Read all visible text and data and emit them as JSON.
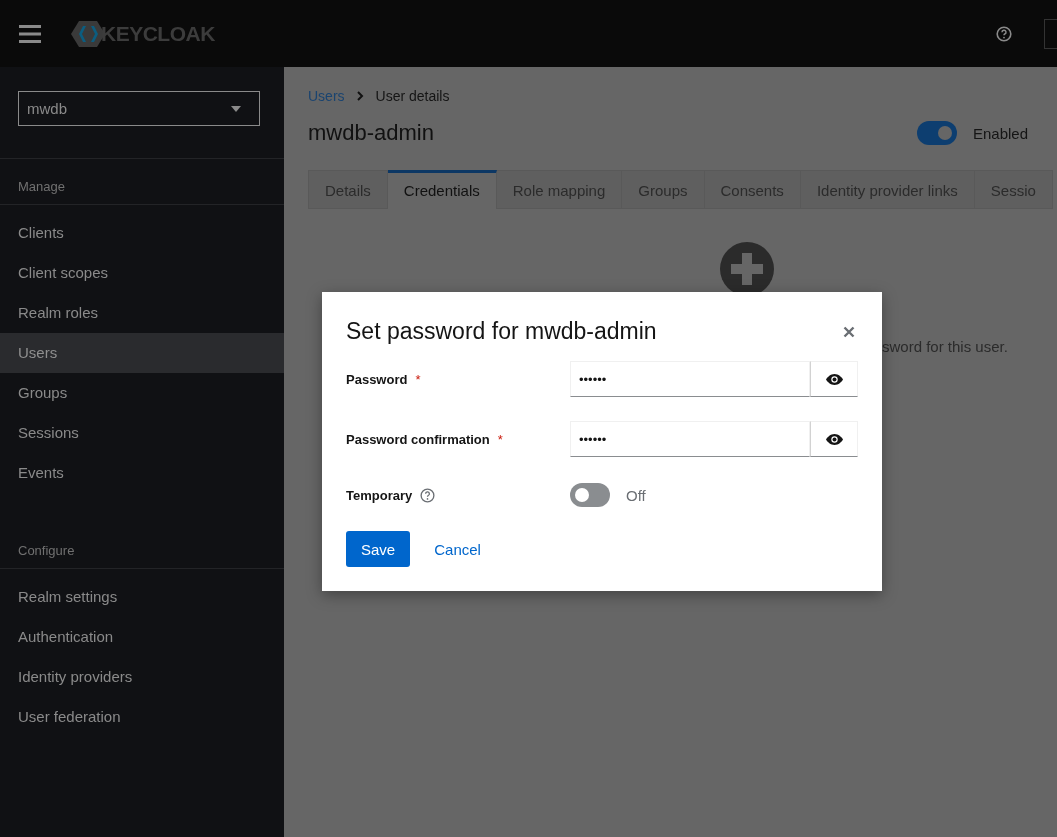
{
  "header": {
    "logo_text": "KEYCLOAK"
  },
  "sidebar": {
    "realm_select": "mwdb",
    "sections": [
      {
        "title": "Manage",
        "items": [
          {
            "label": "Clients",
            "selected": false
          },
          {
            "label": "Client scopes",
            "selected": false
          },
          {
            "label": "Realm roles",
            "selected": false
          },
          {
            "label": "Users",
            "selected": true
          },
          {
            "label": "Groups",
            "selected": false
          },
          {
            "label": "Sessions",
            "selected": false
          },
          {
            "label": "Events",
            "selected": false
          }
        ]
      },
      {
        "title": "Configure",
        "items": [
          {
            "label": "Realm settings",
            "selected": false
          },
          {
            "label": "Authentication",
            "selected": false
          },
          {
            "label": "Identity providers",
            "selected": false
          },
          {
            "label": "User federation",
            "selected": false
          }
        ]
      }
    ]
  },
  "breadcrumb": [
    {
      "label": "Users",
      "kind": "link"
    },
    {
      "label": "User details",
      "kind": "current"
    }
  ],
  "page_title": "mwdb-admin",
  "enabled_toggle": {
    "on": true,
    "label": "Enabled"
  },
  "tabs": [
    {
      "label": "Details",
      "selected": false
    },
    {
      "label": "Credentials",
      "selected": true
    },
    {
      "label": "Role mapping",
      "selected": false
    },
    {
      "label": "Groups",
      "selected": false
    },
    {
      "label": "Consents",
      "selected": false
    },
    {
      "label": "Identity provider links",
      "selected": false
    },
    {
      "label": "Sessio",
      "selected": false
    }
  ],
  "empty_state": {
    "text": "sword for this user."
  },
  "modal": {
    "title": "Set password for mwdb-admin",
    "fields": [
      {
        "kind": "password",
        "label": "Password",
        "required_mark": "*",
        "value": "••••••"
      },
      {
        "kind": "password",
        "label": "Password confirmation",
        "required_mark": "*",
        "value": "••••••"
      },
      {
        "kind": "toggle",
        "label": "Temporary",
        "on": false,
        "state_label": "Off"
      }
    ],
    "buttons": [
      {
        "kind": "primary",
        "label": "Save"
      },
      {
        "kind": "link",
        "label": "Cancel"
      }
    ]
  }
}
